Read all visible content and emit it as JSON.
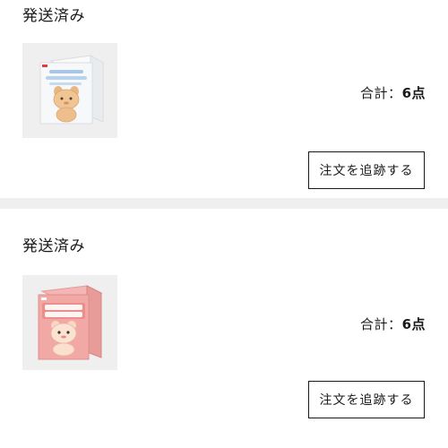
{
  "orders": [
    {
      "status": "発送済み",
      "total_label": "合計：",
      "total_count": "6点",
      "track_label": "注文を追跡する",
      "product_image": "boxed-figure-bear-blue-box"
    },
    {
      "status": "発送済み",
      "total_label": "合計：",
      "total_count": "6点",
      "track_label": "注文を追跡する",
      "product_image": "boxed-figure-bear-pink-box"
    }
  ],
  "colors": {
    "page_background": "#efefef",
    "card_background": "#ffffff",
    "text": "#1a1a1a",
    "thumbnail_background": "#efeff0"
  }
}
